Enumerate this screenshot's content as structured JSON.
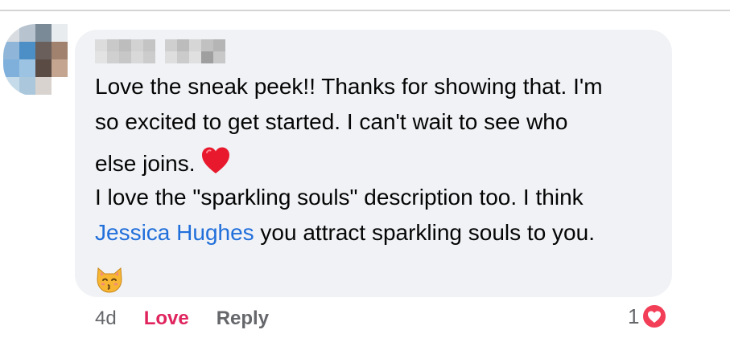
{
  "comment": {
    "author_name": "",
    "text_lines": [
      "Love the sneak peek!! Thanks for showing that. I'm",
      "so excited to get started. I can't wait to see who",
      "else joins.",
      "I love the \"sparkling souls\" description too. I think"
    ],
    "mention": "Jessica Hughes",
    "after_mention": " you attract sparkling souls to you.",
    "emojis": [
      "red-heart-icon",
      "kissing-cat-icon"
    ]
  },
  "actions": {
    "timestamp": "4d",
    "love_label": "Love",
    "reply_label": "Reply"
  },
  "reactions": {
    "count": "1",
    "icon": "love-reaction-icon"
  },
  "colors": {
    "bubble": "#f0f2f5",
    "mention": "#216fdb",
    "love": "#e0245e",
    "muted": "#65676b"
  }
}
